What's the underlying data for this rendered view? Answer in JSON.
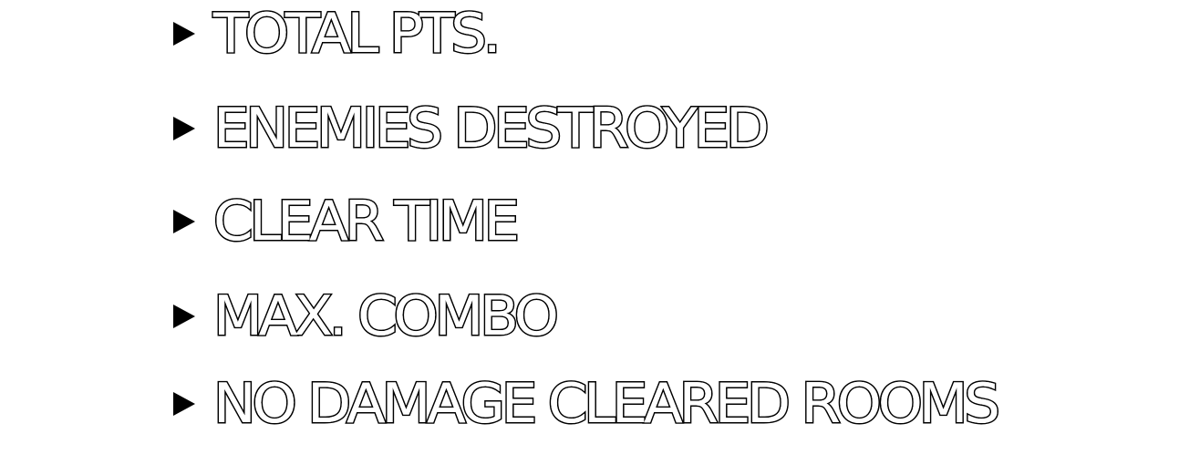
{
  "results_screen": {
    "stats": [
      {
        "label": "TOTAL PTS.",
        "icon": "play-arrow-icon"
      },
      {
        "label": "ENEMIES DESTROYED",
        "icon": "play-arrow-icon"
      },
      {
        "label": "CLEAR TIME",
        "icon": "play-arrow-icon"
      },
      {
        "label": "MAX. COMBO",
        "icon": "play-arrow-icon"
      },
      {
        "label": "NO DAMAGE CLEARED ROOMS",
        "icon": "play-arrow-icon"
      }
    ],
    "colors": {
      "text_fill": "#ffffff",
      "text_outline": "#000000",
      "arrow": "#000000",
      "background": "#ffffff"
    }
  }
}
